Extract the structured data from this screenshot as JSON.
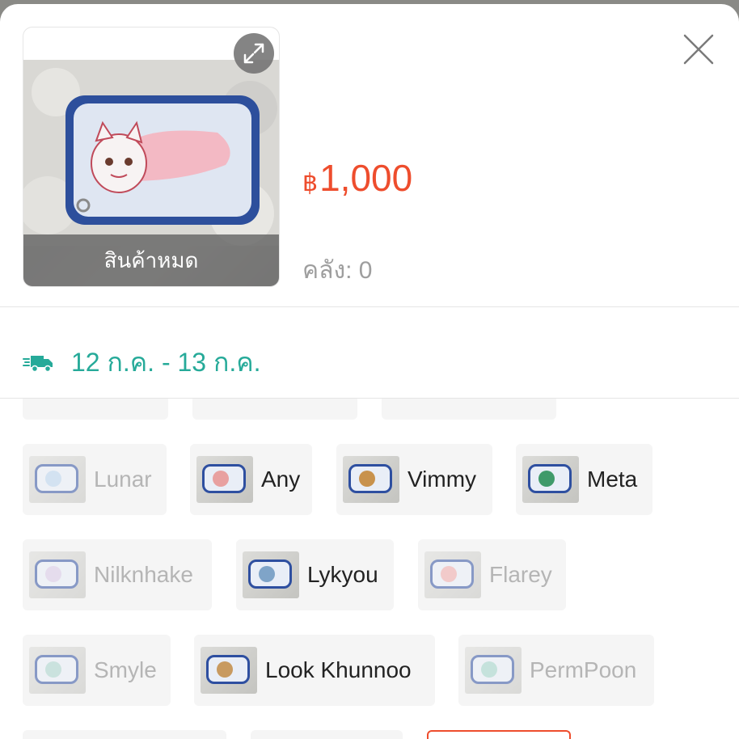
{
  "product": {
    "image_label": "สินค้าหมด",
    "price_currency": "฿",
    "price_value": "1,000",
    "stock": "คลัง: 0",
    "shipping": "12 ก.ค. - 13 ก.ค."
  },
  "options": [
    {
      "label": "Lunar",
      "available": false,
      "color": "#b9d4ee"
    },
    {
      "label": "Any",
      "available": true,
      "color": "#e8a0a0"
    },
    {
      "label": "Vimmy",
      "available": true,
      "color": "#c8924d"
    },
    {
      "label": "Meta",
      "available": true,
      "color": "#3f9a6a"
    },
    {
      "label": "Nilknhake",
      "available": false,
      "color": "#d8c8e8"
    },
    {
      "label": "Lykyou",
      "available": true,
      "color": "#7fa4c8"
    },
    {
      "label": "Flarey",
      "available": false,
      "color": "#f0a8a8"
    },
    {
      "label": "Smyle",
      "available": false,
      "color": "#a8d4cc"
    },
    {
      "label": "Look Khunnoo",
      "available": true,
      "color": "#c89a60"
    },
    {
      "label": "PermPoon",
      "available": false,
      "color": "#9ed4c8"
    }
  ],
  "icons": {
    "expand": "expand-icon",
    "close": "close-icon",
    "shipping": "truck-icon"
  },
  "colors": {
    "price": "#ee4d2d",
    "shipping": "#26aa99",
    "selected_border": "#ee4d2d"
  }
}
